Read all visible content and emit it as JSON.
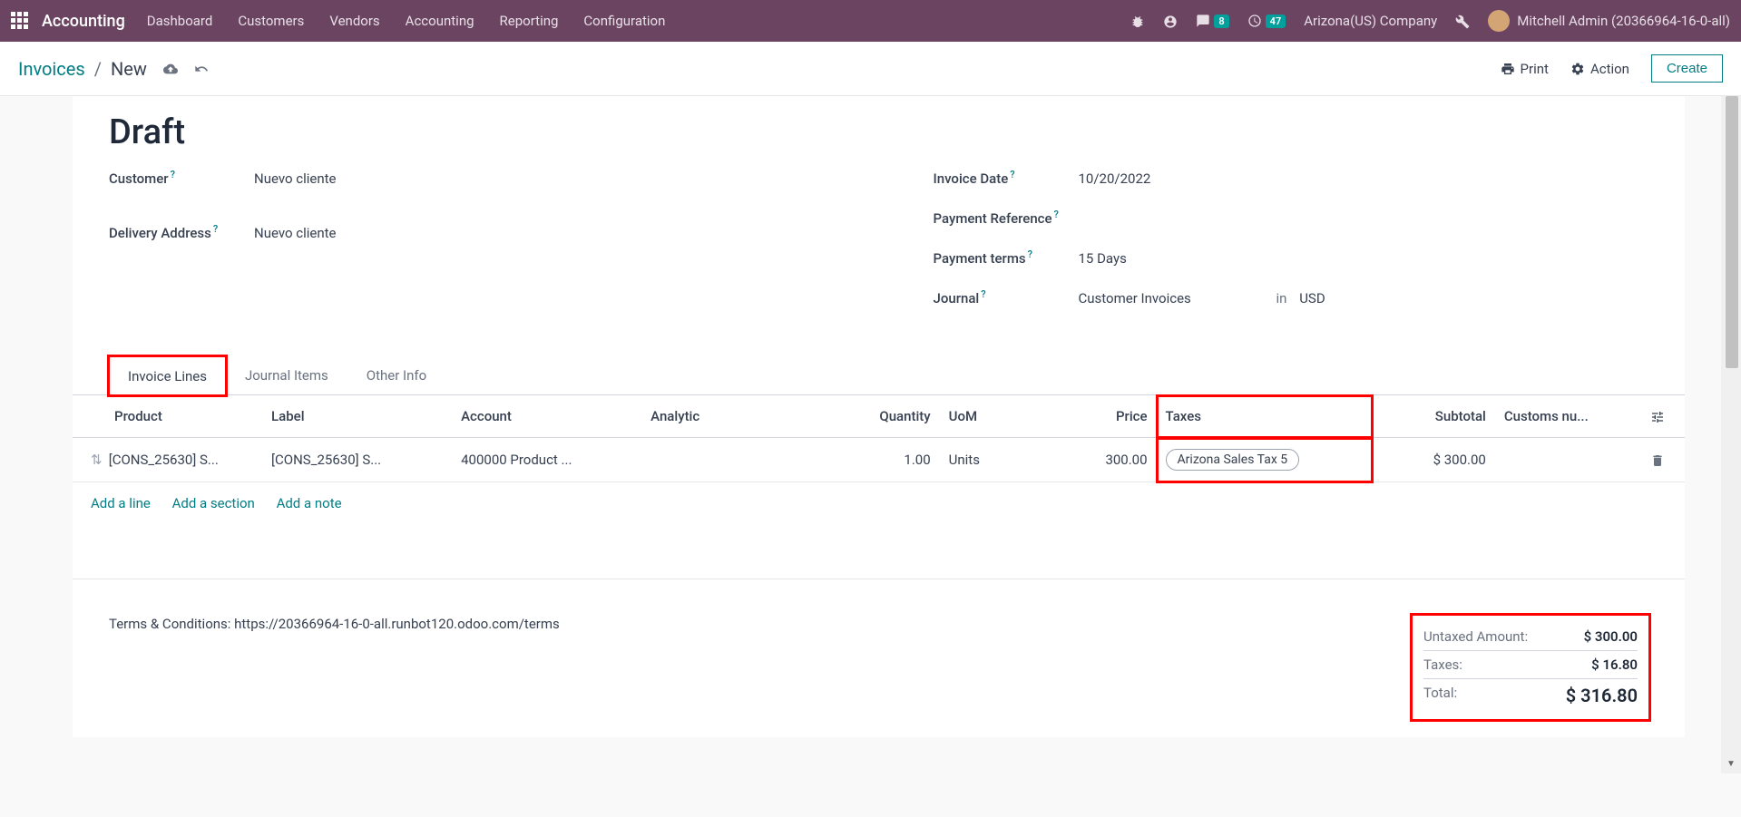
{
  "topnav": {
    "brand": "Accounting",
    "menu": [
      "Dashboard",
      "Customers",
      "Vendors",
      "Accounting",
      "Reporting",
      "Configuration"
    ],
    "messages_badge": "8",
    "activities_badge": "47",
    "company": "Arizona(US) Company",
    "user": "Mitchell Admin (20366964-16-0-all)"
  },
  "subheader": {
    "root": "Invoices",
    "current": "New",
    "print": "Print",
    "action": "Action",
    "create": "Create"
  },
  "form": {
    "title": "Draft",
    "customer_label": "Customer",
    "customer_value": "Nuevo cliente",
    "delivery_label": "Delivery Address",
    "delivery_value": "Nuevo cliente",
    "invoice_date_label": "Invoice Date",
    "invoice_date_value": "10/20/2022",
    "payment_ref_label": "Payment Reference",
    "payment_ref_value": "",
    "payment_terms_label": "Payment terms",
    "payment_terms_value": "15 Days",
    "journal_label": "Journal",
    "journal_value": "Customer Invoices",
    "journal_in": "in",
    "journal_currency": "USD"
  },
  "tabs": [
    "Invoice Lines",
    "Journal Items",
    "Other Info"
  ],
  "table": {
    "headers": {
      "product": "Product",
      "label": "Label",
      "account": "Account",
      "analytic": "Analytic",
      "quantity": "Quantity",
      "uom": "UoM",
      "price": "Price",
      "taxes": "Taxes",
      "subtotal": "Subtotal",
      "customs": "Customs nu..."
    },
    "rows": [
      {
        "product": "[CONS_25630] S...",
        "label": "[CONS_25630] S...",
        "account": "400000 Product ...",
        "analytic": "",
        "quantity": "1.00",
        "uom": "Units",
        "price": "300.00",
        "tax": "Arizona Sales Tax 5",
        "subtotal": "$ 300.00"
      }
    ],
    "add_line": "Add a line",
    "add_section": "Add a section",
    "add_note": "Add a note"
  },
  "footer": {
    "terms": "Terms & Conditions: https://20366964-16-0-all.runbot120.odoo.com/terms",
    "untaxed_label": "Untaxed Amount:",
    "untaxed_value": "$ 300.00",
    "taxes_label": "Taxes:",
    "taxes_value": "$ 16.80",
    "total_label": "Total:",
    "total_value": "$ 316.80"
  }
}
